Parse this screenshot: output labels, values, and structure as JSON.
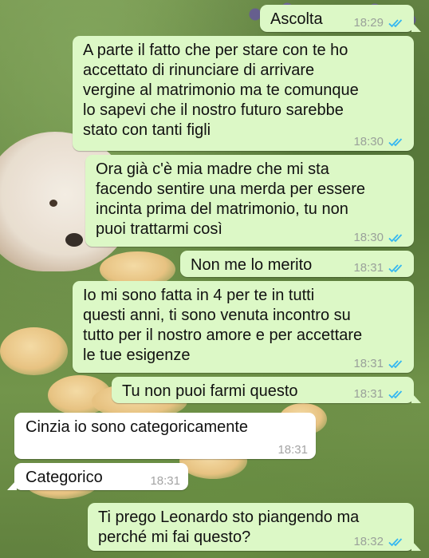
{
  "chat": {
    "messages": [
      {
        "direction": "out",
        "text": "Ascolta",
        "time": "18:29",
        "status": "read"
      },
      {
        "direction": "out",
        "text": "A parte il fatto che per stare con te ho\naccettato di rinunciare di arrivare\nvergine al matrimonio ma te comunque\nlo sapevi che il nostro futuro sarebbe\nstato con tanti figli",
        "time": "18:30",
        "status": "read"
      },
      {
        "direction": "out",
        "text": "Ora già c'è mia madre che mi sta\nfacendo sentire una merda per essere\nincinta prima del matrimonio, tu non\npuoi trattarmi così",
        "time": "18:30",
        "status": "read"
      },
      {
        "direction": "out",
        "text": "Non me lo merito",
        "time": "18:31",
        "status": "read"
      },
      {
        "direction": "out",
        "text": "Io mi sono fatta in 4 per te in tutti\nquesti anni, ti sono venuta incontro su\ntutto per il nostro amore e per accettare\nle tue esigenze",
        "time": "18:31",
        "status": "read"
      },
      {
        "direction": "out",
        "text": "Tu non puoi farmi questo",
        "time": "18:31",
        "status": "read"
      },
      {
        "direction": "in",
        "text": "Cinzia io sono categoricamente",
        "time": "18:31"
      },
      {
        "direction": "in",
        "text": "Categorico",
        "time": "18:31"
      },
      {
        "direction": "out",
        "text": "Ti prego Leonardo sto piangendo ma\nperché mi fai questo?",
        "time": "18:32",
        "status": "read"
      }
    ]
  },
  "icons": {
    "read_receipt": "double-check-icon"
  },
  "colors": {
    "outgoing_bubble": "#dcf8c6",
    "incoming_bubble": "#ffffff",
    "read_ticks": "#34b7f1",
    "timestamp": "#9aa19a"
  }
}
